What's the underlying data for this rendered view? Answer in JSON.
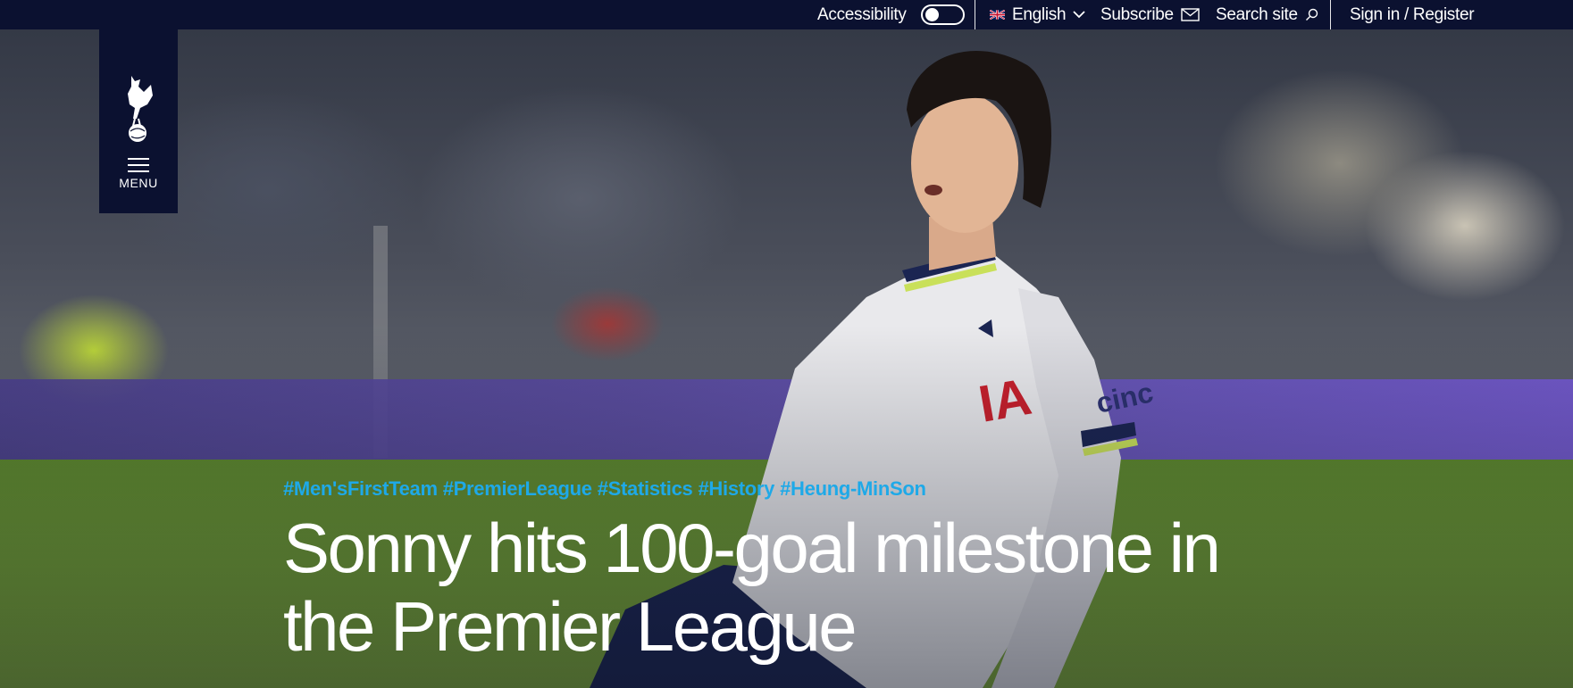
{
  "topbar": {
    "accessibility_label": "Accessibility",
    "accessibility_toggle_state": "off",
    "language_label": "English",
    "subscribe_label": "Subscribe",
    "search_label": "Search site",
    "sign_in_label": "Sign in / Register"
  },
  "menu": {
    "label": "MENU"
  },
  "article": {
    "tags": [
      "#Men'sFirstTeam",
      "#PremierLeague",
      "#Statistics",
      "#History",
      "#Heung-MinSon"
    ],
    "headline": "Sonny hits 100-goal milestone in the Premier League"
  },
  "colors": {
    "navy": "#0b1130",
    "tag_blue": "#1ea9e8",
    "text": "#ffffff"
  },
  "icons": [
    "uk-flag-icon",
    "chevron-down-icon",
    "envelope-icon",
    "search-icon",
    "club-crest-icon",
    "hamburger-icon"
  ]
}
